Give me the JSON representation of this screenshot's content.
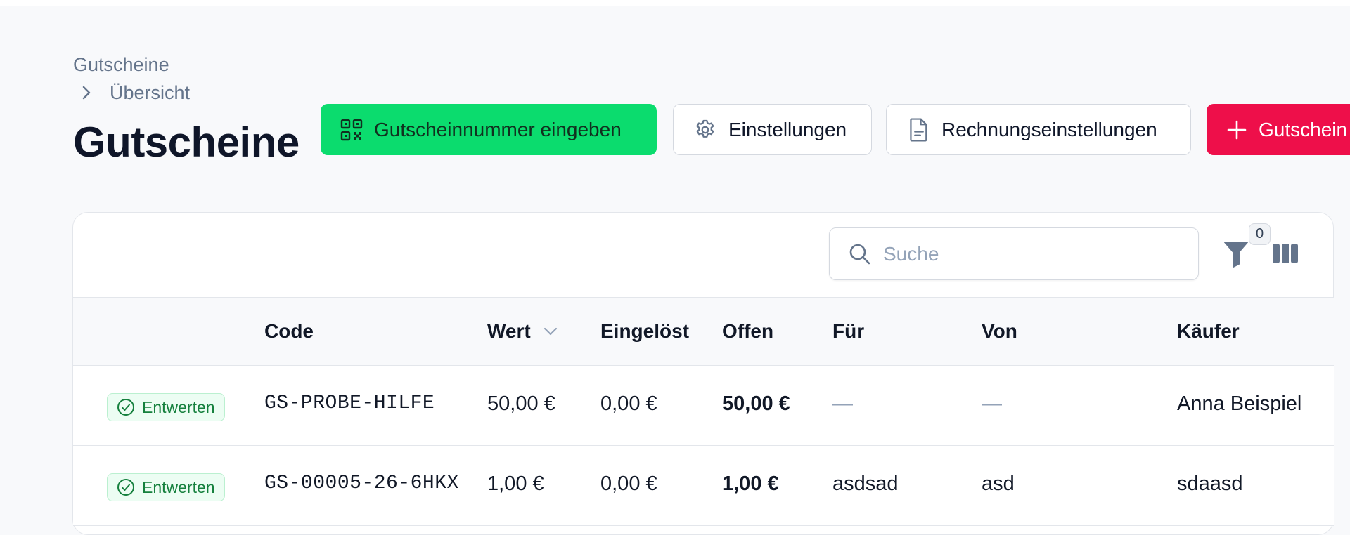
{
  "breadcrumb": {
    "root": "Gutscheine",
    "current": "Übersicht"
  },
  "page_title": "Gutscheine",
  "actions": {
    "enter_code_label": "Gutscheinnummer eingeben",
    "settings_label": "Einstellungen",
    "invoice_settings_label": "Rechnungseinstellungen",
    "create_label": "Gutschein"
  },
  "toolbar": {
    "search_placeholder": "Suche",
    "filter_count": "0"
  },
  "table": {
    "columns": [
      "Code",
      "Wert",
      "Eingelöst",
      "Offen",
      "Für",
      "Von",
      "Käufer"
    ],
    "sort_column": "Wert",
    "rows": [
      {
        "action": "Entwerten",
        "code": "GS-PROBE-HILFE",
        "wert": "50,00 €",
        "eingeloest": "0,00 €",
        "offen": "50,00 €",
        "fuer": "—",
        "von": "—",
        "kaeufer": "Anna Beispiel"
      },
      {
        "action": "Entwerten",
        "code": "GS-00005-26-6HKX",
        "wert": "1,00 €",
        "eingeloest": "0,00 €",
        "offen": "1,00 €",
        "fuer": "asdsad",
        "von": "asd",
        "kaeufer": "sdaasd"
      }
    ]
  },
  "colors": {
    "primary_green": "#0bdc6e",
    "danger_red": "#ee0f4a",
    "badge_green": "#15803d"
  }
}
